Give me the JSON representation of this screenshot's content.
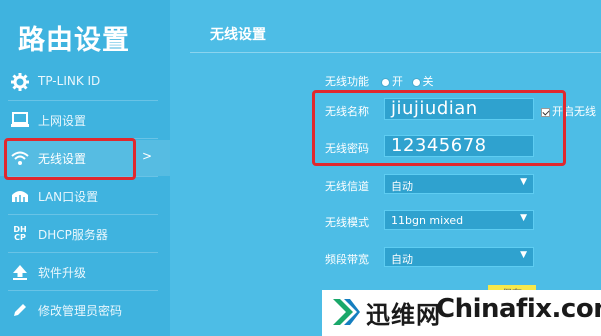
{
  "sidebar": {
    "title": "路由设置",
    "items": [
      {
        "label": "TP-LINK ID",
        "icon": "gear-icon"
      },
      {
        "label": "上网设置",
        "icon": "monitor-icon"
      },
      {
        "label": "无线设置",
        "icon": "wifi-icon",
        "active": true,
        "chevron": ">"
      },
      {
        "label": "LAN口设置",
        "icon": "lan-icon"
      },
      {
        "label": "DHCP服务器",
        "icon": "dhcp-icon",
        "icon_text": "DH\nCP"
      },
      {
        "label": "软件升级",
        "icon": "upgrade-icon"
      },
      {
        "label": "修改管理员密码",
        "icon": "pencil-icon"
      }
    ]
  },
  "main": {
    "title": "无线设置",
    "wireless_function": {
      "label": "无线功能",
      "on": "开",
      "off": "关"
    },
    "ssid": {
      "label": "无线名称",
      "value": "jiujiudian"
    },
    "password": {
      "label": "无线密码",
      "value": "12345678"
    },
    "broadcast": {
      "label": "开启无线"
    },
    "channel": {
      "label": "无线信道",
      "value": "自动"
    },
    "mode": {
      "label": "无线模式",
      "value": "11bgn mixed"
    },
    "bandwidth": {
      "label": "频段带宽",
      "value": "自动"
    },
    "save_label": "保存"
  },
  "watermark": {
    "brand": "迅维网",
    "site": "Chinafix.com"
  },
  "colors": {
    "highlight": "#e0282e",
    "background": "#4dbde6",
    "save": "#f7e84a"
  }
}
